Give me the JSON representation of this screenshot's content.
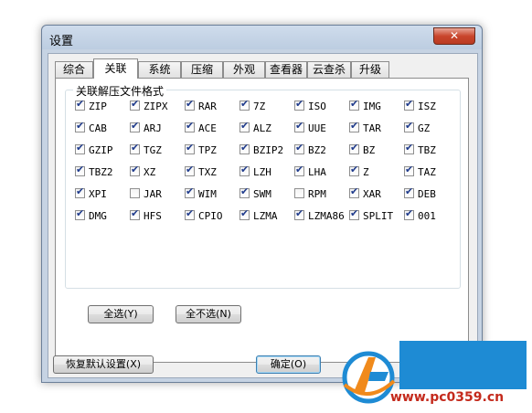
{
  "window": {
    "title": "设置",
    "close_label": "✕"
  },
  "tabs": [
    {
      "label": "综合",
      "active": false
    },
    {
      "label": "关联",
      "active": true
    },
    {
      "label": "系统",
      "active": false
    },
    {
      "label": "压缩",
      "active": false
    },
    {
      "label": "外观",
      "active": false
    },
    {
      "label": "查看器",
      "active": false
    },
    {
      "label": "云查杀",
      "active": false
    },
    {
      "label": "升级",
      "active": false
    }
  ],
  "group": {
    "title": "关联解压文件格式"
  },
  "formats": [
    [
      {
        "label": "ZIP",
        "checked": true
      },
      {
        "label": "ZIPX",
        "checked": true
      },
      {
        "label": "RAR",
        "checked": true
      },
      {
        "label": "7Z",
        "checked": true
      },
      {
        "label": "ISO",
        "checked": true
      },
      {
        "label": "IMG",
        "checked": true
      },
      {
        "label": "ISZ",
        "checked": true
      }
    ],
    [
      {
        "label": "CAB",
        "checked": true
      },
      {
        "label": "ARJ",
        "checked": true
      },
      {
        "label": "ACE",
        "checked": true
      },
      {
        "label": "ALZ",
        "checked": true
      },
      {
        "label": "UUE",
        "checked": true
      },
      {
        "label": "TAR",
        "checked": true
      },
      {
        "label": "GZ",
        "checked": true
      }
    ],
    [
      {
        "label": "GZIP",
        "checked": true
      },
      {
        "label": "TGZ",
        "checked": true
      },
      {
        "label": "TPZ",
        "checked": true
      },
      {
        "label": "BZIP2",
        "checked": true
      },
      {
        "label": "BZ2",
        "checked": true
      },
      {
        "label": "BZ",
        "checked": true
      },
      {
        "label": "TBZ",
        "checked": true
      }
    ],
    [
      {
        "label": "TBZ2",
        "checked": true
      },
      {
        "label": "XZ",
        "checked": true
      },
      {
        "label": "TXZ",
        "checked": true
      },
      {
        "label": "LZH",
        "checked": true
      },
      {
        "label": "LHA",
        "checked": true
      },
      {
        "label": "Z",
        "checked": true
      },
      {
        "label": "TAZ",
        "checked": true
      }
    ],
    [
      {
        "label": "XPI",
        "checked": true
      },
      {
        "label": "JAR",
        "checked": false
      },
      {
        "label": "WIM",
        "checked": true
      },
      {
        "label": "SWM",
        "checked": true
      },
      {
        "label": "RPM",
        "checked": false
      },
      {
        "label": "XAR",
        "checked": true
      },
      {
        "label": "DEB",
        "checked": true
      }
    ],
    [
      {
        "label": "DMG",
        "checked": true
      },
      {
        "label": "HFS",
        "checked": true
      },
      {
        "label": "CPIO",
        "checked": true
      },
      {
        "label": "LZMA",
        "checked": true
      },
      {
        "label": "LZMA86",
        "checked": true
      },
      {
        "label": "SPLIT",
        "checked": true
      },
      {
        "label": "001",
        "checked": true
      }
    ]
  ],
  "buttons": {
    "select_all": "全选(Y)",
    "select_none": "全不选(N)",
    "restore_defaults": "恢复默认设置(X)",
    "ok": "确定(O)"
  },
  "watermark": {
    "url": "www.pc0359.cn"
  },
  "colors": {
    "frame": "#c6d3e3",
    "close": "#c9462c",
    "check": "#1f3b8c",
    "watermark_blue": "#1e8bd4",
    "watermark_red": "#c42a1c"
  }
}
